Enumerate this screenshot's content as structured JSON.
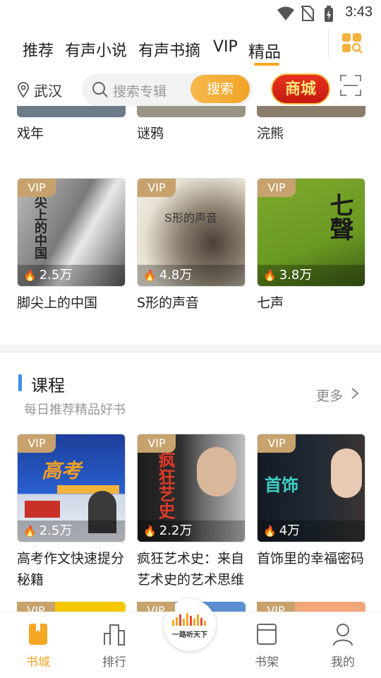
{
  "status_bar": {
    "time": "3:43"
  },
  "tabs": [
    {
      "label": "推荐"
    },
    {
      "label": "有声小说"
    },
    {
      "label": "有声书摘"
    },
    {
      "label": "VIP"
    },
    {
      "label": "精品"
    }
  ],
  "active_tab": "精品",
  "location": {
    "city": "武汉"
  },
  "search": {
    "placeholder": "搜索专辑",
    "button": "搜索"
  },
  "mall_button": "商城",
  "top_partial_titles": [
    "戏年",
    "谜鸦",
    "浣熊"
  ],
  "row1": [
    {
      "badge": "VIP",
      "plays": "2.5万",
      "title": "脚尖上的中国",
      "cover_text": "尖上的中国"
    },
    {
      "badge": "VIP",
      "plays": "4.8万",
      "title": "S形的声音",
      "cover_text": "S形的声音"
    },
    {
      "badge": "VIP",
      "plays": "3.8万",
      "title": "七声",
      "cover_text": "七聲"
    }
  ],
  "section": {
    "title": "课程",
    "subtitle": "每日推荐精品好书",
    "more": "更多"
  },
  "row2": [
    {
      "badge": "VIP",
      "plays": "2.5万",
      "title": "高考作文快速提分秘籍",
      "cover_text": "高考"
    },
    {
      "badge": "VIP",
      "plays": "2.2万",
      "title": "疯狂艺术史：来自艺术史的艺术思维",
      "cover_text": "疯狂艺史"
    },
    {
      "badge": "VIP",
      "plays": "4万",
      "title": "首饰里的幸福密码",
      "cover_text": "首饰"
    }
  ],
  "row3_badges": [
    "VIP",
    "VIP",
    "VIP"
  ],
  "nav": [
    {
      "label": "书城"
    },
    {
      "label": "排行"
    },
    {
      "label": "书架"
    },
    {
      "label": "我的"
    }
  ],
  "center_logo_text": "一路听天下",
  "colors": {
    "accent": "#f5a623",
    "vip": "#c7a26d",
    "section_bar": "#3b8ef0",
    "mall": "#d82a18"
  }
}
